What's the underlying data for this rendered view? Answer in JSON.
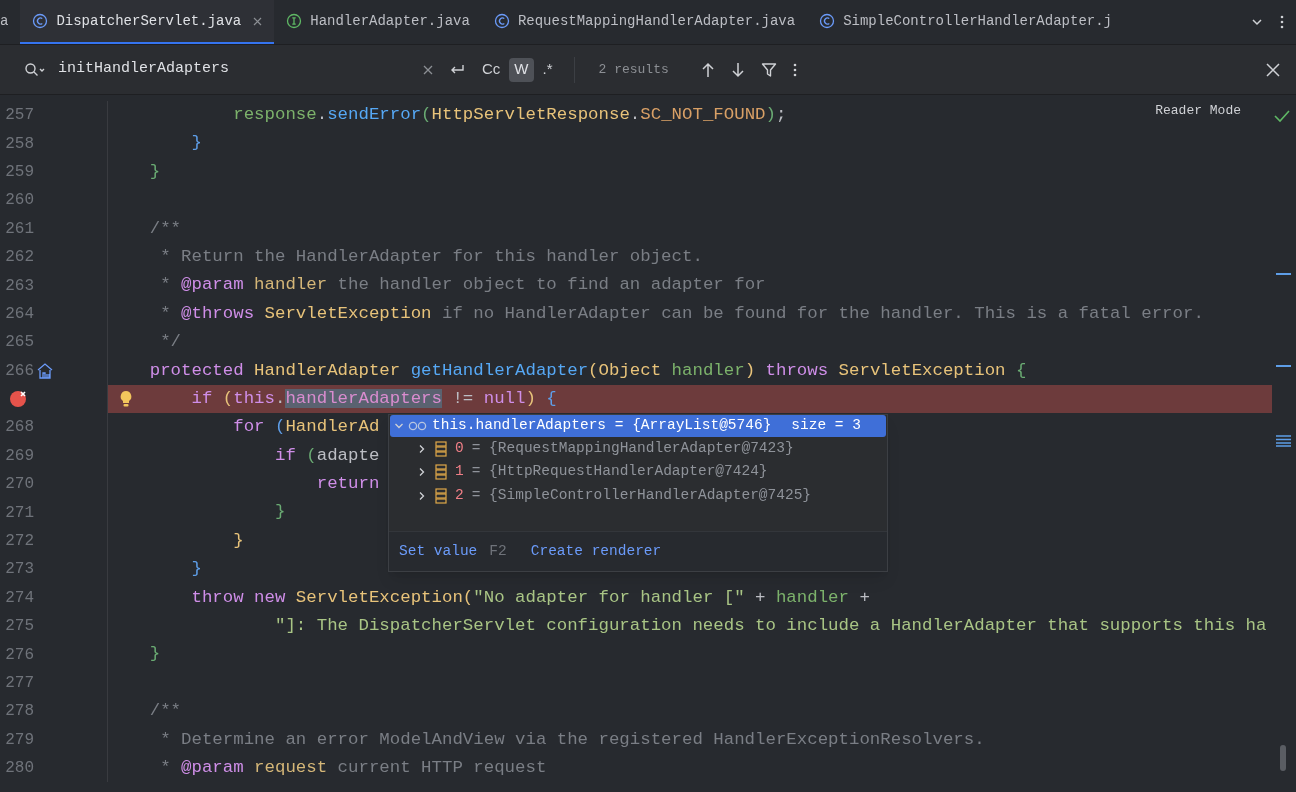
{
  "tabs": [
    {
      "label": "a",
      "kind": "none",
      "selected": false,
      "closable": false
    },
    {
      "label": "DispatcherServlet.java",
      "kind": "class",
      "selected": true,
      "closable": true
    },
    {
      "label": "HandlerAdapter.java",
      "kind": "interface",
      "selected": false,
      "closable": false
    },
    {
      "label": "RequestMappingHandlerAdapter.java",
      "kind": "class",
      "selected": false,
      "closable": false
    },
    {
      "label": "SimpleControllerHandlerAdapter.j",
      "kind": "class",
      "selected": false,
      "closable": false
    }
  ],
  "search": {
    "value": "initHandlerAdapters",
    "options": [
      {
        "label": "Cc",
        "selected": false
      },
      {
        "label": "W",
        "selected": true
      },
      {
        "label": ".*",
        "selected": false
      }
    ],
    "results": "2 results"
  },
  "editor": {
    "reader_mode": "Reader Mode",
    "lines": [
      {
        "number": "257",
        "kind": "code",
        "breakpoint": false,
        "tokens": [
          {
            "kind": "param",
            "text": "            response"
          },
          {
            "kind": "plain",
            "text": "."
          },
          {
            "kind": "fn",
            "text": "sendError"
          },
          {
            "kind": "b1",
            "text": "("
          },
          {
            "kind": "type",
            "text": "HttpServletResponse"
          },
          {
            "kind": "plain",
            "text": "."
          },
          {
            "kind": "const",
            "text": "SC_NOT_FOUND"
          },
          {
            "kind": "b1",
            "text": ")"
          },
          {
            "kind": "plain",
            "text": ";"
          }
        ]
      },
      {
        "number": "258",
        "kind": "code",
        "breakpoint": false,
        "tokens": [
          {
            "kind": "b2",
            "text": "        }"
          }
        ]
      },
      {
        "number": "259",
        "kind": "code",
        "breakpoint": false,
        "tokens": [
          {
            "kind": "b1",
            "text": "    }"
          }
        ]
      },
      {
        "number": "260",
        "kind": "code",
        "breakpoint": false
      },
      {
        "number": "261",
        "kind": "code",
        "breakpoint": false,
        "tokens": [
          {
            "kind": "comment",
            "text": "    /**"
          }
        ]
      },
      {
        "number": "262",
        "kind": "code",
        "breakpoint": false,
        "tokens": [
          {
            "kind": "comment",
            "text": "     * Return the HandlerAdapter for this handler object."
          }
        ]
      },
      {
        "number": "263",
        "kind": "code",
        "breakpoint": false,
        "tokens": [
          {
            "kind": "comment",
            "text": "     *"
          },
          {
            "kind": "tag",
            "text": " @param"
          },
          {
            "kind": "tagparam",
            "text": " handler"
          },
          {
            "kind": "comment",
            "text": " the handler object to find an adapter for"
          }
        ]
      },
      {
        "number": "264",
        "kind": "code",
        "breakpoint": false,
        "tokens": [
          {
            "kind": "comment",
            "text": "     *"
          },
          {
            "kind": "tag",
            "text": " @throws"
          },
          {
            "kind": "type",
            "text": " ServletException"
          },
          {
            "kind": "comment",
            "text": " if no HandlerAdapter can be found for the handler. This is a fatal error."
          }
        ]
      },
      {
        "number": "265",
        "kind": "code",
        "breakpoint": false,
        "tokens": [
          {
            "kind": "comment",
            "text": "     */"
          }
        ]
      },
      {
        "number": "266",
        "kind": "implementation",
        "breakpoint": false,
        "tokens": [
          {
            "kind": "kw",
            "text": "    protected"
          },
          {
            "kind": "type",
            "text": " HandlerAdapter"
          },
          {
            "kind": "fn",
            "text": " getHandlerAdapter"
          },
          {
            "kind": "b3",
            "text": "("
          },
          {
            "kind": "type",
            "text": "Object"
          },
          {
            "kind": "param",
            "text": " handler"
          },
          {
            "kind": "b3",
            "text": ")"
          },
          {
            "kind": "kw",
            "text": " throws"
          },
          {
            "kind": "type",
            "text": " ServletException"
          },
          {
            "kind": "b1",
            "text": " {"
          }
        ]
      },
      {
        "kind": "intention",
        "breakpoint": true,
        "tokens": [
          {
            "kind": "kw",
            "text": "        if"
          },
          {
            "kind": "b3",
            "text": " ("
          },
          {
            "kind": "kw",
            "text": "this"
          },
          {
            "kind": "plain",
            "text": "."
          },
          {
            "kind": "field",
            "text": "handlerAdapters",
            "match": true
          },
          {
            "kind": "plain",
            "text": " !="
          },
          {
            "kind": "kw",
            "text": " null"
          },
          {
            "kind": "b3",
            "text": ")"
          },
          {
            "kind": "b2",
            "text": " {"
          }
        ]
      },
      {
        "number": "268",
        "kind": "code",
        "breakpoint": false,
        "tokens": [
          {
            "kind": "kw",
            "text": "            for"
          },
          {
            "kind": "b2",
            "text": " ("
          },
          {
            "kind": "type",
            "text": "HandlerAd"
          }
        ]
      },
      {
        "number": "269",
        "kind": "code",
        "breakpoint": false,
        "tokens": [
          {
            "kind": "kw",
            "text": "                if"
          },
          {
            "kind": "b1",
            "text": " ("
          },
          {
            "kind": "plain",
            "text": "adapte"
          }
        ]
      },
      {
        "number": "270",
        "kind": "code",
        "breakpoint": false,
        "tokens": [
          {
            "kind": "kw",
            "text": "                    return"
          }
        ]
      },
      {
        "number": "271",
        "kind": "code",
        "breakpoint": false,
        "tokens": [
          {
            "kind": "b1",
            "text": "                }"
          }
        ]
      },
      {
        "number": "272",
        "kind": "code",
        "breakpoint": false,
        "tokens": [
          {
            "kind": "b3",
            "text": "            }"
          }
        ]
      },
      {
        "number": "273",
        "kind": "code",
        "breakpoint": false,
        "tokens": [
          {
            "kind": "b2",
            "text": "        }"
          }
        ]
      },
      {
        "number": "274",
        "kind": "code",
        "breakpoint": false,
        "tokens": [
          {
            "kind": "kw",
            "text": "        throw"
          },
          {
            "kind": "kw",
            "text": " new"
          },
          {
            "kind": "type",
            "text": " ServletException"
          },
          {
            "kind": "b3",
            "text": "("
          },
          {
            "kind": "str",
            "text": "\"No adapter for handler [\""
          },
          {
            "kind": "plain",
            "text": " +"
          },
          {
            "kind": "param",
            "text": " handler"
          },
          {
            "kind": "plain",
            "text": " +"
          }
        ]
      },
      {
        "number": "275",
        "kind": "code",
        "breakpoint": false,
        "tokens": [
          {
            "kind": "str",
            "text": "                \"]: The DispatcherServlet configuration needs to include a HandlerAdapter that supports this ha"
          }
        ]
      },
      {
        "number": "276",
        "kind": "code",
        "breakpoint": false,
        "tokens": [
          {
            "kind": "b1",
            "text": "    }"
          }
        ]
      },
      {
        "number": "277",
        "kind": "code",
        "breakpoint": false
      },
      {
        "number": "278",
        "kind": "code",
        "breakpoint": false,
        "tokens": [
          {
            "kind": "comment",
            "text": "    /**"
          }
        ]
      },
      {
        "number": "279",
        "kind": "code",
        "breakpoint": false,
        "tokens": [
          {
            "kind": "comment",
            "text": "     * Determine an error ModelAndView via the registered HandlerExceptionResolvers."
          }
        ]
      },
      {
        "number": "280",
        "kind": "code",
        "breakpoint": false,
        "tokens": [
          {
            "kind": "comment",
            "text": "     *"
          },
          {
            "kind": "tag",
            "text": " @param"
          },
          {
            "kind": "tagparam",
            "text": " request"
          },
          {
            "kind": "comment",
            "text": " current HTTP request"
          }
        ]
      }
    ]
  },
  "debug_popup": {
    "root": {
      "name": "this.handlerAdapters = {ArrayList@5746}",
      "size": "size = 3",
      "expanded": true,
      "selected": true
    },
    "children": [
      {
        "name": "0",
        "value": "= {RequestMappingHandlerAdapter@7423}",
        "expanded": false
      },
      {
        "name": "1",
        "value": "= {HttpRequestHandlerAdapter@7424}",
        "expanded": false
      },
      {
        "name": "2",
        "value": "= {SimpleControllerHandlerAdapter@7425}",
        "expanded": false
      }
    ],
    "actions": [
      {
        "label": "Set value",
        "shortcut": "F2"
      },
      {
        "label": "Create renderer"
      }
    ]
  }
}
